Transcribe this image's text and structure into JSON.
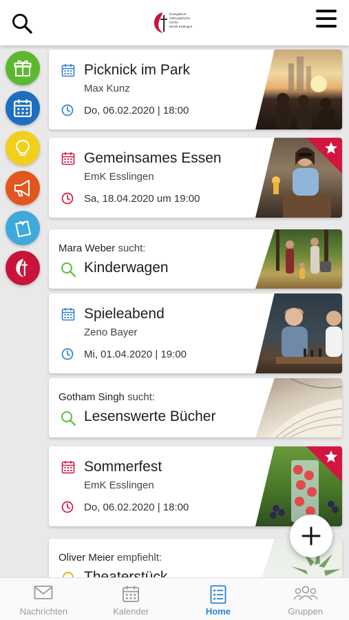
{
  "header": {
    "logo_lines": [
      "Evangelisch-",
      "methodistische",
      "Kirche",
      "Bezirk Esslingen"
    ]
  },
  "rail": [
    {
      "name": "gift",
      "color": "#5cb82e"
    },
    {
      "name": "calendar",
      "color": "#1f6fc0"
    },
    {
      "name": "lightbulb",
      "color": "#f1cf1c"
    },
    {
      "name": "megaphone",
      "color": "#e2571f"
    },
    {
      "name": "note",
      "color": "#3fa9dc"
    },
    {
      "name": "church",
      "color": "#c8143b"
    }
  ],
  "cards": [
    {
      "type": "event",
      "title": "Picknick im Park",
      "sub": "Max Kunz",
      "date": "Do, 06.02.2020 | 18:00",
      "color": "#2a7fd6",
      "starred": false
    },
    {
      "type": "event",
      "title": "Gemeinsames Essen",
      "sub": "EmK Esslingen",
      "date": "Sa, 18.04.2020 um 19:00",
      "color": "#d2163f",
      "starred": true
    },
    {
      "type": "search",
      "user": "Mara Weber",
      "verb": "sucht:",
      "term": "Kinderwagen"
    },
    {
      "type": "event",
      "title": "Spieleabend",
      "sub": "Zeno Bayer",
      "date": "Mi, 01.04.2020 | 19:00",
      "color": "#2a7fd6",
      "starred": false
    },
    {
      "type": "search",
      "user": "Gotham Singh",
      "verb": "sucht:",
      "term": "Lesenswerte Bücher"
    },
    {
      "type": "event",
      "title": "Sommerfest",
      "sub": "EmK Esslingen",
      "date": "Do, 06.02.2020 | 18:00",
      "color": "#d2163f",
      "starred": true
    },
    {
      "type": "recommend",
      "user": "Oliver Meier",
      "verb": "empfiehlt:",
      "term": "Theaterstück"
    }
  ],
  "nav": [
    {
      "label": "Nachrichten",
      "icon": "envelope-icon",
      "active": false
    },
    {
      "label": "Kalender",
      "icon": "calendar-icon",
      "active": false
    },
    {
      "label": "Home",
      "icon": "list-icon",
      "active": true
    },
    {
      "label": "Gruppen",
      "icon": "group-icon",
      "active": false
    }
  ]
}
